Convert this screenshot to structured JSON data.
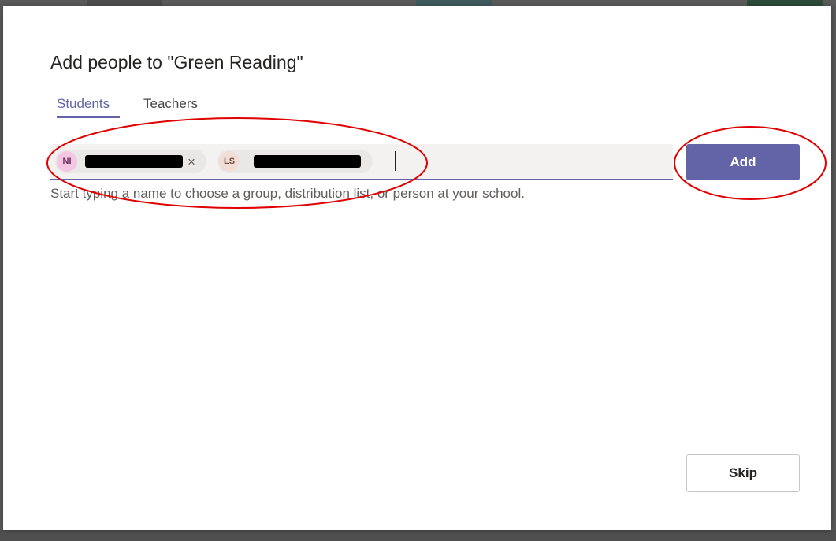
{
  "dialog": {
    "title": "Add people to \"Green Reading\"",
    "tabs": [
      {
        "label": "Students",
        "active": true
      },
      {
        "label": "Teachers",
        "active": false
      }
    ],
    "people_picker": {
      "selected": [
        {
          "initials": "NI",
          "name": "[redacted]"
        },
        {
          "initials": "LS",
          "name": "[redacted]"
        }
      ],
      "remove_glyph": "×",
      "value": ""
    },
    "helper_text": "Start typing a name to choose a group, distribution list, or person at your school.",
    "add_button": "Add",
    "skip_button": "Skip"
  },
  "colors": {
    "accent": "#6264a7",
    "annotation": "#e00000"
  }
}
